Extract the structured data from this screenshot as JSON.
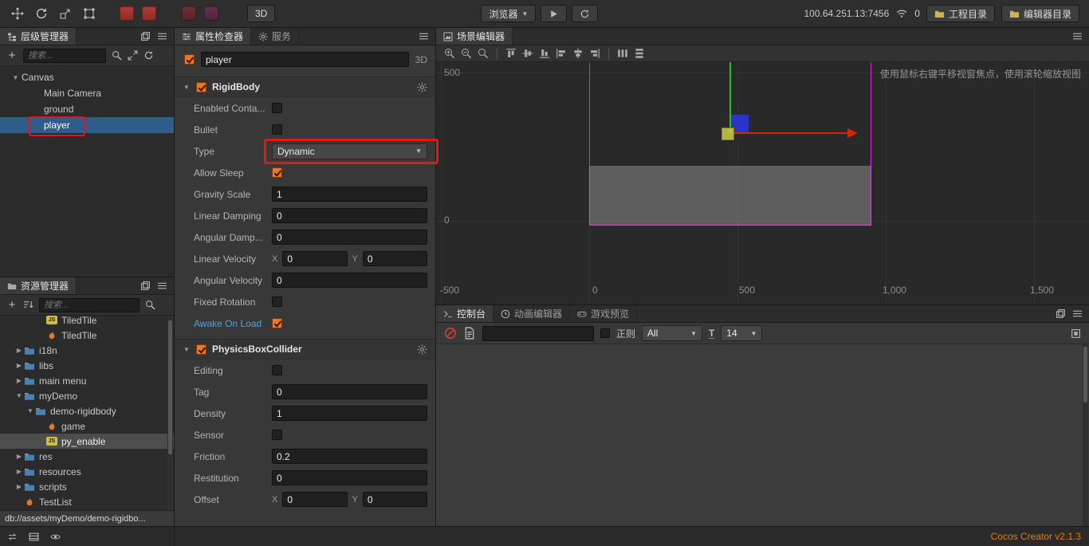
{
  "colors": {
    "accent_orange": "#ee7621",
    "selection_blue": "#2e5d8c",
    "annotation_red": "#e41717",
    "brand_orange": "#e87a10",
    "link_blue": "#57a0dd",
    "frame_magenta": "#d620d6",
    "gizmo_green": "#25c025",
    "gizmo_red": "#dd2200",
    "sprite_blue": "#2a35c5",
    "js_yellow": "#cdbc45"
  },
  "toolbar": {
    "mode_3d": "3D",
    "browser_label": "浏览器",
    "address": "100.64.251.13:7456",
    "connections": "0",
    "project_dir": "工程目录",
    "editor_dir": "编辑器目录"
  },
  "hierarchy": {
    "title": "层级管理器",
    "search_placeholder": "搜索...",
    "nodes": [
      {
        "label": "Canv{as}",
        "depth": 0,
        "arrow": "down"
      },
      {
        "label": "Main Camera",
        "depth": 1
      },
      {
        "label": "ground",
        "depth": 1
      },
      {
        "label": "player",
        "depth": 1,
        "selected": true
      }
    ]
  },
  "assets": {
    "title": "资源管理器",
    "search_placeholder": "搜索...",
    "items": [
      {
        "label": "TiledTile",
        "icon": "js",
        "depth": 3,
        "clipped": true
      },
      {
        "label": "TiledTile",
        "icon": "flame",
        "depth": 3
      },
      {
        "label": "i18n",
        "icon": "folder",
        "depth": 1,
        "arrow": "right"
      },
      {
        "label": "libs",
        "icon": "folder",
        "depth": 1,
        "arrow": "right"
      },
      {
        "label": "main menu",
        "icon": "folder",
        "depth": 1,
        "arrow": "right"
      },
      {
        "label": "myDemo",
        "icon": "folder",
        "depth": 1,
        "arrow": "down"
      },
      {
        "label": "demo-rigidbody",
        "icon": "folder",
        "depth": 2,
        "arrow": "down"
      },
      {
        "label": "game",
        "icon": "flame",
        "depth": 3
      },
      {
        "label": "py_enable",
        "icon": "js",
        "depth": 3,
        "selected": true
      },
      {
        "label": "res",
        "icon": "folder",
        "depth": 1,
        "arrow": "right"
      },
      {
        "label": "resources",
        "icon": "folder",
        "depth": 1,
        "arrow": "right"
      },
      {
        "label": "scripts",
        "icon": "folder",
        "depth": 1,
        "arrow": "right"
      },
      {
        "label": "TestList",
        "icon": "flame",
        "depth": 1
      }
    ],
    "status_path": "db://assets/myDemo/demo-rigidbo..."
  },
  "inspector": {
    "tab_properties": "属性检查器",
    "tab_services": "服务",
    "node_name": "player",
    "mode_label": "3D",
    "components": [
      {
        "name": "RigidBody",
        "enabled": true,
        "properties": [
          {
            "label": "Enabled Conta...",
            "type": "checkbox",
            "checked": false
          },
          {
            "label": "Bullet",
            "type": "checkbox",
            "checked": false
          },
          {
            "label": "Type",
            "type": "select",
            "value": "Dynamic",
            "annotated": true
          },
          {
            "label": "Allow Sleep",
            "type": "checkbox",
            "checked": true
          },
          {
            "label": "Gravity Scale",
            "type": "input",
            "value": "1"
          },
          {
            "label": "Linear Damping",
            "type": "input",
            "value": "0"
          },
          {
            "label": "Angular Damp...",
            "type": "input",
            "value": "0"
          },
          {
            "label": "Linear Velocity",
            "type": "vec2",
            "x": "0",
            "y": "0"
          },
          {
            "label": "Angular Velocity",
            "type": "input",
            "value": "0"
          },
          {
            "label": "Fixed Rotation",
            "type": "checkbox",
            "checked": false
          },
          {
            "label": "Awake On Load",
            "type": "checkbox",
            "checked": true,
            "link": true
          }
        ]
      },
      {
        "name": "PhysicsBoxCollider",
        "enabled": true,
        "properties": [
          {
            "label": "Editing",
            "type": "checkbox",
            "checked": false
          },
          {
            "label": "Tag",
            "type": "input",
            "value": "0"
          },
          {
            "label": "Density",
            "type": "input",
            "value": "1"
          },
          {
            "label": "Sensor",
            "type": "checkbox",
            "checked": false
          },
          {
            "label": "Friction",
            "type": "input",
            "value": "0.2"
          },
          {
            "label": "Restitution",
            "type": "input",
            "value": "0"
          },
          {
            "label": "Offset",
            "type": "vec2",
            "x": "0",
            "y": "0"
          }
        ]
      }
    ]
  },
  "scene": {
    "title": "场景编辑器",
    "hint": "使用鼠标右键平移视窗焦点，使用滚轮缩放视图",
    "ruler_y": [
      "500",
      "0",
      "-500"
    ],
    "ruler_x": [
      "0",
      "500",
      "1,000",
      "1,500"
    ],
    "toolbar_icons": [
      "zoom-in",
      "zoom-out",
      "zoom-reset",
      "sep",
      "align-top",
      "align-vcenter",
      "align-bottom",
      "align-left",
      "align-hcenter",
      "align-right",
      "sep",
      "distribute-h",
      "distribute-v"
    ]
  },
  "console": {
    "tab_console": "控制台",
    "tab_animation": "动画编辑器",
    "tab_preview": "游戏预览",
    "regex_label": "正则",
    "filter_value": "All",
    "font_size_value": "14"
  },
  "footer": {
    "version": "Cocos Creator v2.1.3"
  }
}
